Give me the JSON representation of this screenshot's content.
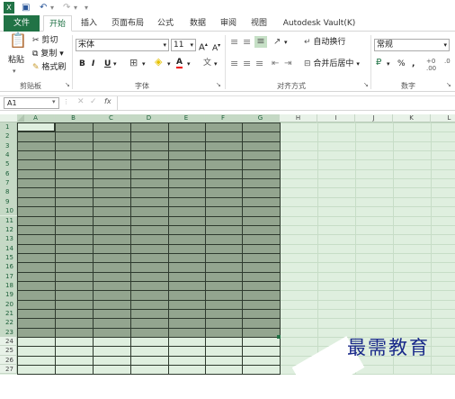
{
  "title_bar": {
    "app_icon": "excel-icon",
    "save_icon": "save-icon",
    "undo_icon": "undo-icon",
    "redo_icon": "redo-icon"
  },
  "tabs": [
    {
      "label": "文件"
    },
    {
      "label": "开始"
    },
    {
      "label": "插入"
    },
    {
      "label": "页面布局"
    },
    {
      "label": "公式"
    },
    {
      "label": "数据"
    },
    {
      "label": "审阅"
    },
    {
      "label": "视图"
    },
    {
      "label": "Autodesk Vault(K)"
    }
  ],
  "ribbon": {
    "clipboard": {
      "paste": "粘贴",
      "cut": "剪切",
      "copy": "复制",
      "format_painter": "格式刷",
      "group_label": "剪贴板"
    },
    "font": {
      "font_name": "宋体",
      "font_size": "11",
      "grow": "A",
      "shrink": "A",
      "bold": "B",
      "italic": "I",
      "underline": "U",
      "group_label": "字体"
    },
    "alignment": {
      "wrap": "自动换行",
      "merge": "合并后居中",
      "group_label": "对齐方式"
    },
    "number": {
      "format": "常规",
      "percent": "%",
      "comma": ",",
      "group_label": "数字"
    }
  },
  "formula_bar": {
    "name_box": "A1",
    "fx": "fx",
    "cancel": "✕",
    "confirm": "✓"
  },
  "columns": [
    "A",
    "B",
    "C",
    "D",
    "E",
    "F",
    "G",
    "H",
    "I",
    "J",
    "K",
    "L"
  ],
  "rows": [
    "1",
    "2",
    "3",
    "4",
    "5",
    "6",
    "7",
    "8",
    "9",
    "10",
    "11",
    "12",
    "13",
    "14",
    "15",
    "16",
    "17",
    "18",
    "19",
    "20",
    "21",
    "22",
    "23",
    "24",
    "25",
    "26",
    "27"
  ],
  "watermark": "最需教育",
  "colors": {
    "accent": "#217346",
    "selection": "#93a58f",
    "border": "#2e3a2e",
    "sheet_bg": "#dfefdf"
  }
}
